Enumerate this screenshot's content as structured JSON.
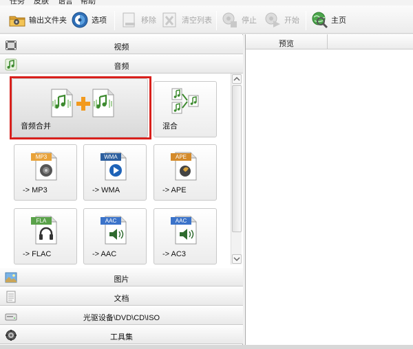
{
  "menubar": {
    "items": [
      "任务",
      "皮肤",
      "语言",
      "帮助"
    ]
  },
  "toolbar": {
    "output_folder": "输出文件夹",
    "options": "选项",
    "remove": "移除",
    "clear_list": "清空列表",
    "stop": "停止",
    "start": "开始",
    "home": "主页"
  },
  "categories": {
    "video": "视频",
    "audio": "音频",
    "picture": "图片",
    "document": "文档",
    "rom": "光驱设备\\DVD\\CD\\ISO",
    "tools": "工具集"
  },
  "tiles": {
    "audio_join": "音频合并",
    "mix": "混合",
    "mp3": "-> MP3",
    "wma": "-> WMA",
    "ape": "-> APE",
    "flac": "-> FLAC",
    "aac": "-> AAC",
    "ac3": "-> AC3"
  },
  "badges": {
    "mp3": "MP3",
    "wma": "WMA",
    "ape": "APE",
    "fla": "FLA",
    "aac": "AAC",
    "ac3": "AAC"
  },
  "preview": {
    "header": "预览"
  },
  "colors": {
    "highlight": "#d9201c",
    "mp3_badge": "#e8a23a",
    "wma_badge": "#2d5f9e",
    "ape_badge": "#d48a2a",
    "fla_badge": "#5aa24a",
    "aac_badge": "#3b73c9"
  }
}
